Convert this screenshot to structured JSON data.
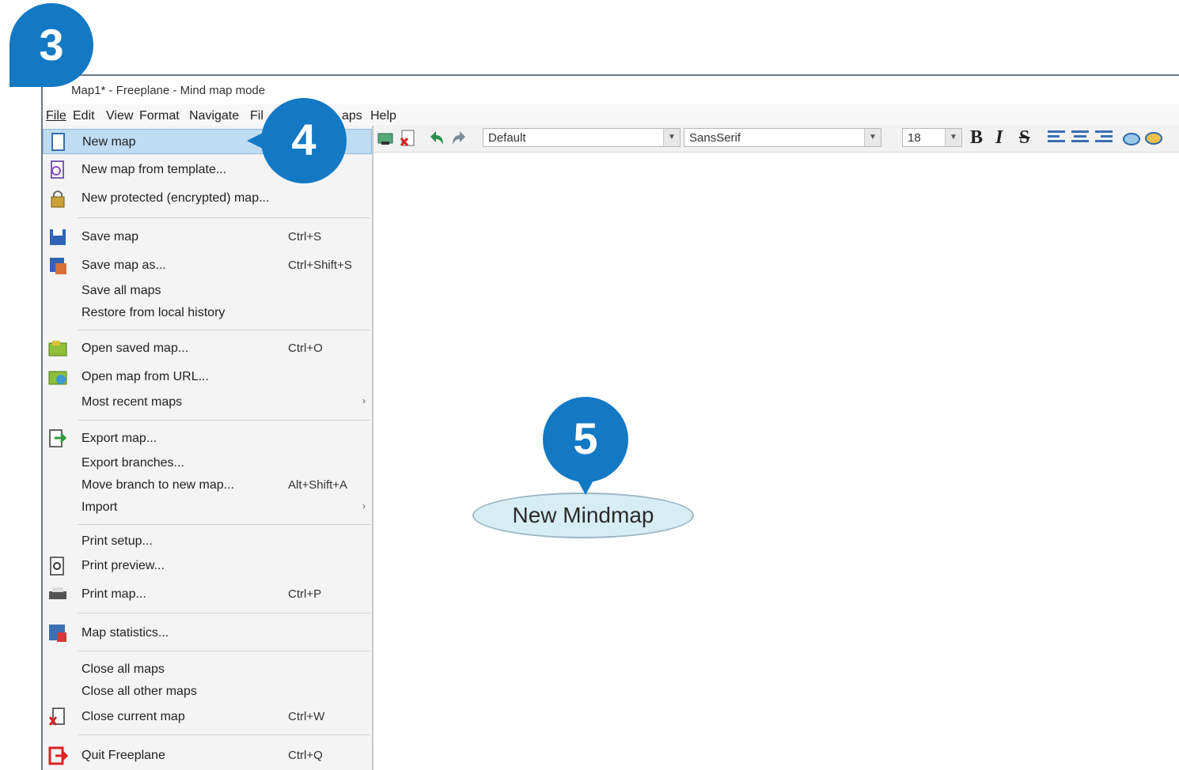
{
  "window": {
    "title": "Map1* - Freeplane - Mind map mode"
  },
  "menubar": {
    "items": [
      "File",
      "Edit",
      "View",
      "Format",
      "Navigate",
      "Fil",
      "aps",
      "Help"
    ]
  },
  "toolbar": {
    "style_combo": "Default",
    "font_combo": "SansSerif",
    "size_combo": "18",
    "bold": "B",
    "italic": "I",
    "strike": "S"
  },
  "file_menu": {
    "items": [
      {
        "label": "New map",
        "shortcut": "",
        "icon": "new-map-icon"
      },
      {
        "label": "New map from template...",
        "shortcut": "",
        "icon": "template-icon"
      },
      {
        "label": "New protected (encrypted) map...",
        "shortcut": "",
        "icon": "lock-icon"
      },
      {
        "label": "Save map",
        "shortcut": "Ctrl+S",
        "icon": "save-icon"
      },
      {
        "label": "Save map as...",
        "shortcut": "Ctrl+Shift+S",
        "icon": "save-as-icon"
      },
      {
        "label": "Save all maps",
        "shortcut": ""
      },
      {
        "label": "Restore from local history",
        "shortcut": ""
      },
      {
        "label": "Open saved map...",
        "shortcut": "Ctrl+O",
        "icon": "open-icon"
      },
      {
        "label": "Open map from URL...",
        "shortcut": "",
        "icon": "open-url-icon"
      },
      {
        "label": "Most recent maps",
        "shortcut": "",
        "submenu": true
      },
      {
        "label": "Export map...",
        "shortcut": "",
        "icon": "export-icon"
      },
      {
        "label": "Export branches...",
        "shortcut": ""
      },
      {
        "label": "Move branch to new map...",
        "shortcut": "Alt+Shift+A"
      },
      {
        "label": "Import",
        "shortcut": "",
        "submenu": true
      },
      {
        "label": "Print setup...",
        "shortcut": ""
      },
      {
        "label": "Print preview...",
        "shortcut": "",
        "icon": "print-preview-icon"
      },
      {
        "label": "Print map...",
        "shortcut": "Ctrl+P",
        "icon": "printer-icon"
      },
      {
        "label": "Map statistics...",
        "shortcut": "",
        "icon": "statistics-icon"
      },
      {
        "label": "Close all maps",
        "shortcut": ""
      },
      {
        "label": "Close all other maps",
        "shortcut": ""
      },
      {
        "label": "Close current map",
        "shortcut": "Ctrl+W",
        "icon": "close-map-icon"
      },
      {
        "label": "Quit Freeplane",
        "shortcut": "Ctrl+Q",
        "icon": "quit-icon"
      }
    ]
  },
  "map": {
    "root_node": "New Mindmap"
  },
  "callouts": [
    "3",
    "4",
    "5"
  ],
  "colors": {
    "callout": "#1379c5",
    "highlight": "#bfdcf3",
    "node_fill": "#d6eef3"
  }
}
